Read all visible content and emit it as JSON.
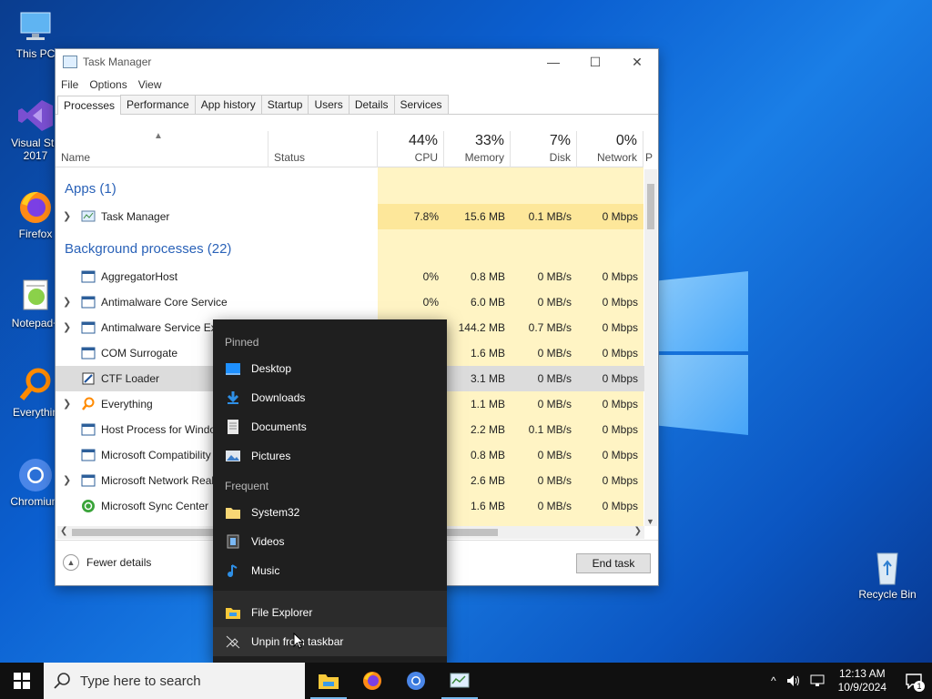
{
  "desktop": {
    "icons": [
      {
        "label": "This PC"
      },
      {
        "label": "Visual Stu"
      },
      {
        "label": "2017"
      },
      {
        "label": "Firefox"
      },
      {
        "label": "Notepad+"
      },
      {
        "label": "Everythin"
      },
      {
        "label": "Chromium"
      },
      {
        "label": "Recycle Bin"
      }
    ]
  },
  "taskmanager": {
    "title": "Task Manager",
    "menu": [
      "File",
      "Options",
      "View"
    ],
    "tabs": [
      "Processes",
      "Performance",
      "App history",
      "Startup",
      "Users",
      "Details",
      "Services"
    ],
    "columns": {
      "name": "Name",
      "status": "Status",
      "cpu": {
        "pct": "44%",
        "label": "CPU"
      },
      "memory": {
        "pct": "33%",
        "label": "Memory"
      },
      "disk": {
        "pct": "7%",
        "label": "Disk"
      },
      "network": {
        "pct": "0%",
        "label": "Network"
      },
      "power": "P"
    },
    "groups": {
      "apps": "Apps (1)",
      "background": "Background processes (22)"
    },
    "rows": [
      {
        "name": "Task Manager",
        "cpu": "7.8%",
        "mem": "15.6 MB",
        "disk": "0.1 MB/s",
        "net": "0 Mbps"
      },
      {
        "name": "AggregatorHost",
        "cpu": "0%",
        "mem": "0.8 MB",
        "disk": "0 MB/s",
        "net": "0 Mbps"
      },
      {
        "name": "Antimalware Core Service",
        "cpu": "0%",
        "mem": "6.0 MB",
        "disk": "0 MB/s",
        "net": "0 Mbps"
      },
      {
        "name": "Antimalware Service Executable",
        "cpu": "",
        "mem": "144.2 MB",
        "disk": "0.7 MB/s",
        "net": "0 Mbps"
      },
      {
        "name": "COM Surrogate",
        "cpu": "",
        "mem": "1.6 MB",
        "disk": "0 MB/s",
        "net": "0 Mbps"
      },
      {
        "name": "CTF Loader",
        "cpu": "",
        "mem": "3.1 MB",
        "disk": "0 MB/s",
        "net": "0 Mbps"
      },
      {
        "name": "Everything",
        "cpu": "",
        "mem": "1.1 MB",
        "disk": "0 MB/s",
        "net": "0 Mbps"
      },
      {
        "name": "Host Process for Windows Tasks",
        "cpu": "",
        "mem": "2.2 MB",
        "disk": "0.1 MB/s",
        "net": "0 Mbps"
      },
      {
        "name": "Microsoft Compatibility Telemetry",
        "cpu": "",
        "mem": "0.8 MB",
        "disk": "0 MB/s",
        "net": "0 Mbps"
      },
      {
        "name": "Microsoft Network Realtime Inspection",
        "cpu": "",
        "mem": "2.6 MB",
        "disk": "0 MB/s",
        "net": "0 Mbps"
      },
      {
        "name": "Microsoft Sync Center",
        "cpu": "",
        "mem": "1.6 MB",
        "disk": "0 MB/s",
        "net": "0 Mbps"
      }
    ],
    "fewer_details": "Fewer details",
    "end_task": "End task"
  },
  "jumplist": {
    "pinned_header": "Pinned",
    "pinned": [
      "Desktop",
      "Downloads",
      "Documents",
      "Pictures"
    ],
    "frequent_header": "Frequent",
    "frequent": [
      "System32",
      "Videos",
      "Music"
    ],
    "app": "File Explorer",
    "unpin": "Unpin from taskbar"
  },
  "taskbar": {
    "search_placeholder": "Type here to search",
    "time": "12:13 AM",
    "date": "10/9/2024",
    "notification_count": "1"
  }
}
